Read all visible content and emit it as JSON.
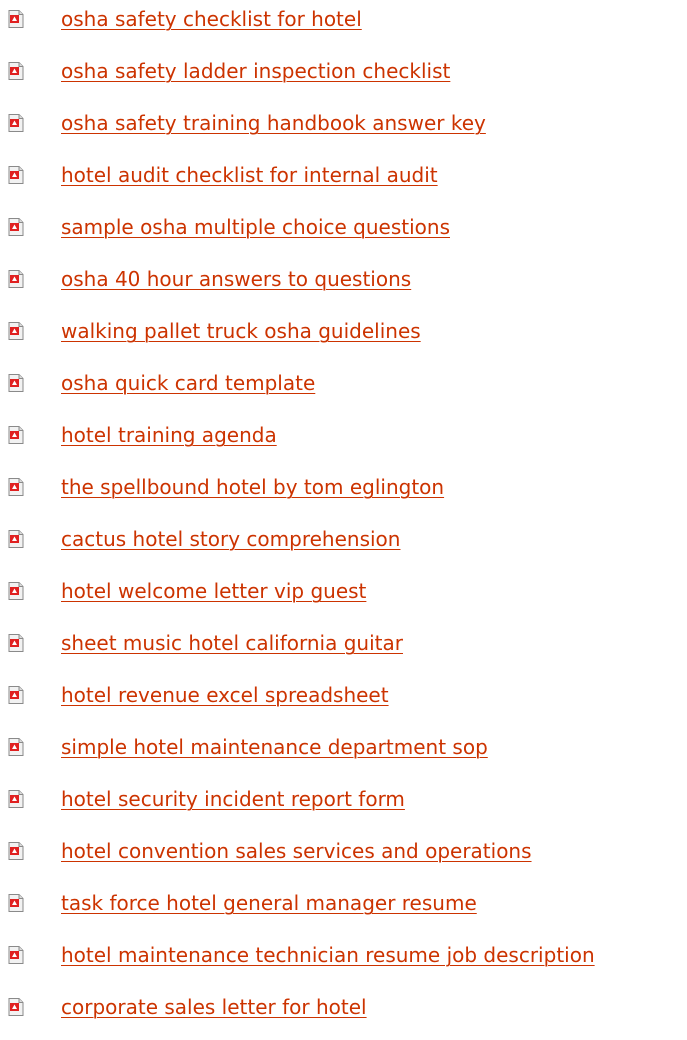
{
  "links": [
    {
      "label": "osha safety checklist for hotel",
      "icon": "pdf-file-icon"
    },
    {
      "label": "osha safety ladder inspection checklist",
      "icon": "pdf-file-icon"
    },
    {
      "label": "osha safety training handbook answer key",
      "icon": "pdf-file-icon"
    },
    {
      "label": "hotel audit checklist for internal audit",
      "icon": "pdf-file-icon"
    },
    {
      "label": "sample osha multiple choice questions",
      "icon": "pdf-file-icon"
    },
    {
      "label": "osha 40 hour answers to questions",
      "icon": "pdf-file-icon"
    },
    {
      "label": "walking pallet truck osha guidelines",
      "icon": "pdf-file-icon"
    },
    {
      "label": "osha quick card template",
      "icon": "pdf-file-icon"
    },
    {
      "label": "hotel training agenda",
      "icon": "pdf-file-icon"
    },
    {
      "label": "the spellbound hotel by tom eglington",
      "icon": "pdf-file-icon"
    },
    {
      "label": "cactus hotel story comprehension",
      "icon": "pdf-file-icon"
    },
    {
      "label": "hotel welcome letter vip guest",
      "icon": "pdf-file-icon"
    },
    {
      "label": "sheet music hotel california guitar",
      "icon": "pdf-file-icon"
    },
    {
      "label": "hotel revenue excel spreadsheet",
      "icon": "pdf-file-icon"
    },
    {
      "label": "simple hotel maintenance department sop",
      "icon": "pdf-file-icon"
    },
    {
      "label": "hotel security incident report form",
      "icon": "pdf-file-icon"
    },
    {
      "label": "hotel convention sales services and operations",
      "icon": "pdf-file-icon"
    },
    {
      "label": "task force hotel general manager resume",
      "icon": "pdf-file-icon"
    },
    {
      "label": "hotel maintenance technician resume job description",
      "icon": "pdf-file-icon"
    },
    {
      "label": "corporate sales letter for hotel",
      "icon": "pdf-file-icon"
    }
  ],
  "colors": {
    "link": "#cc3300",
    "icon_red": "#e02020",
    "icon_page": "#f2f2f2"
  }
}
